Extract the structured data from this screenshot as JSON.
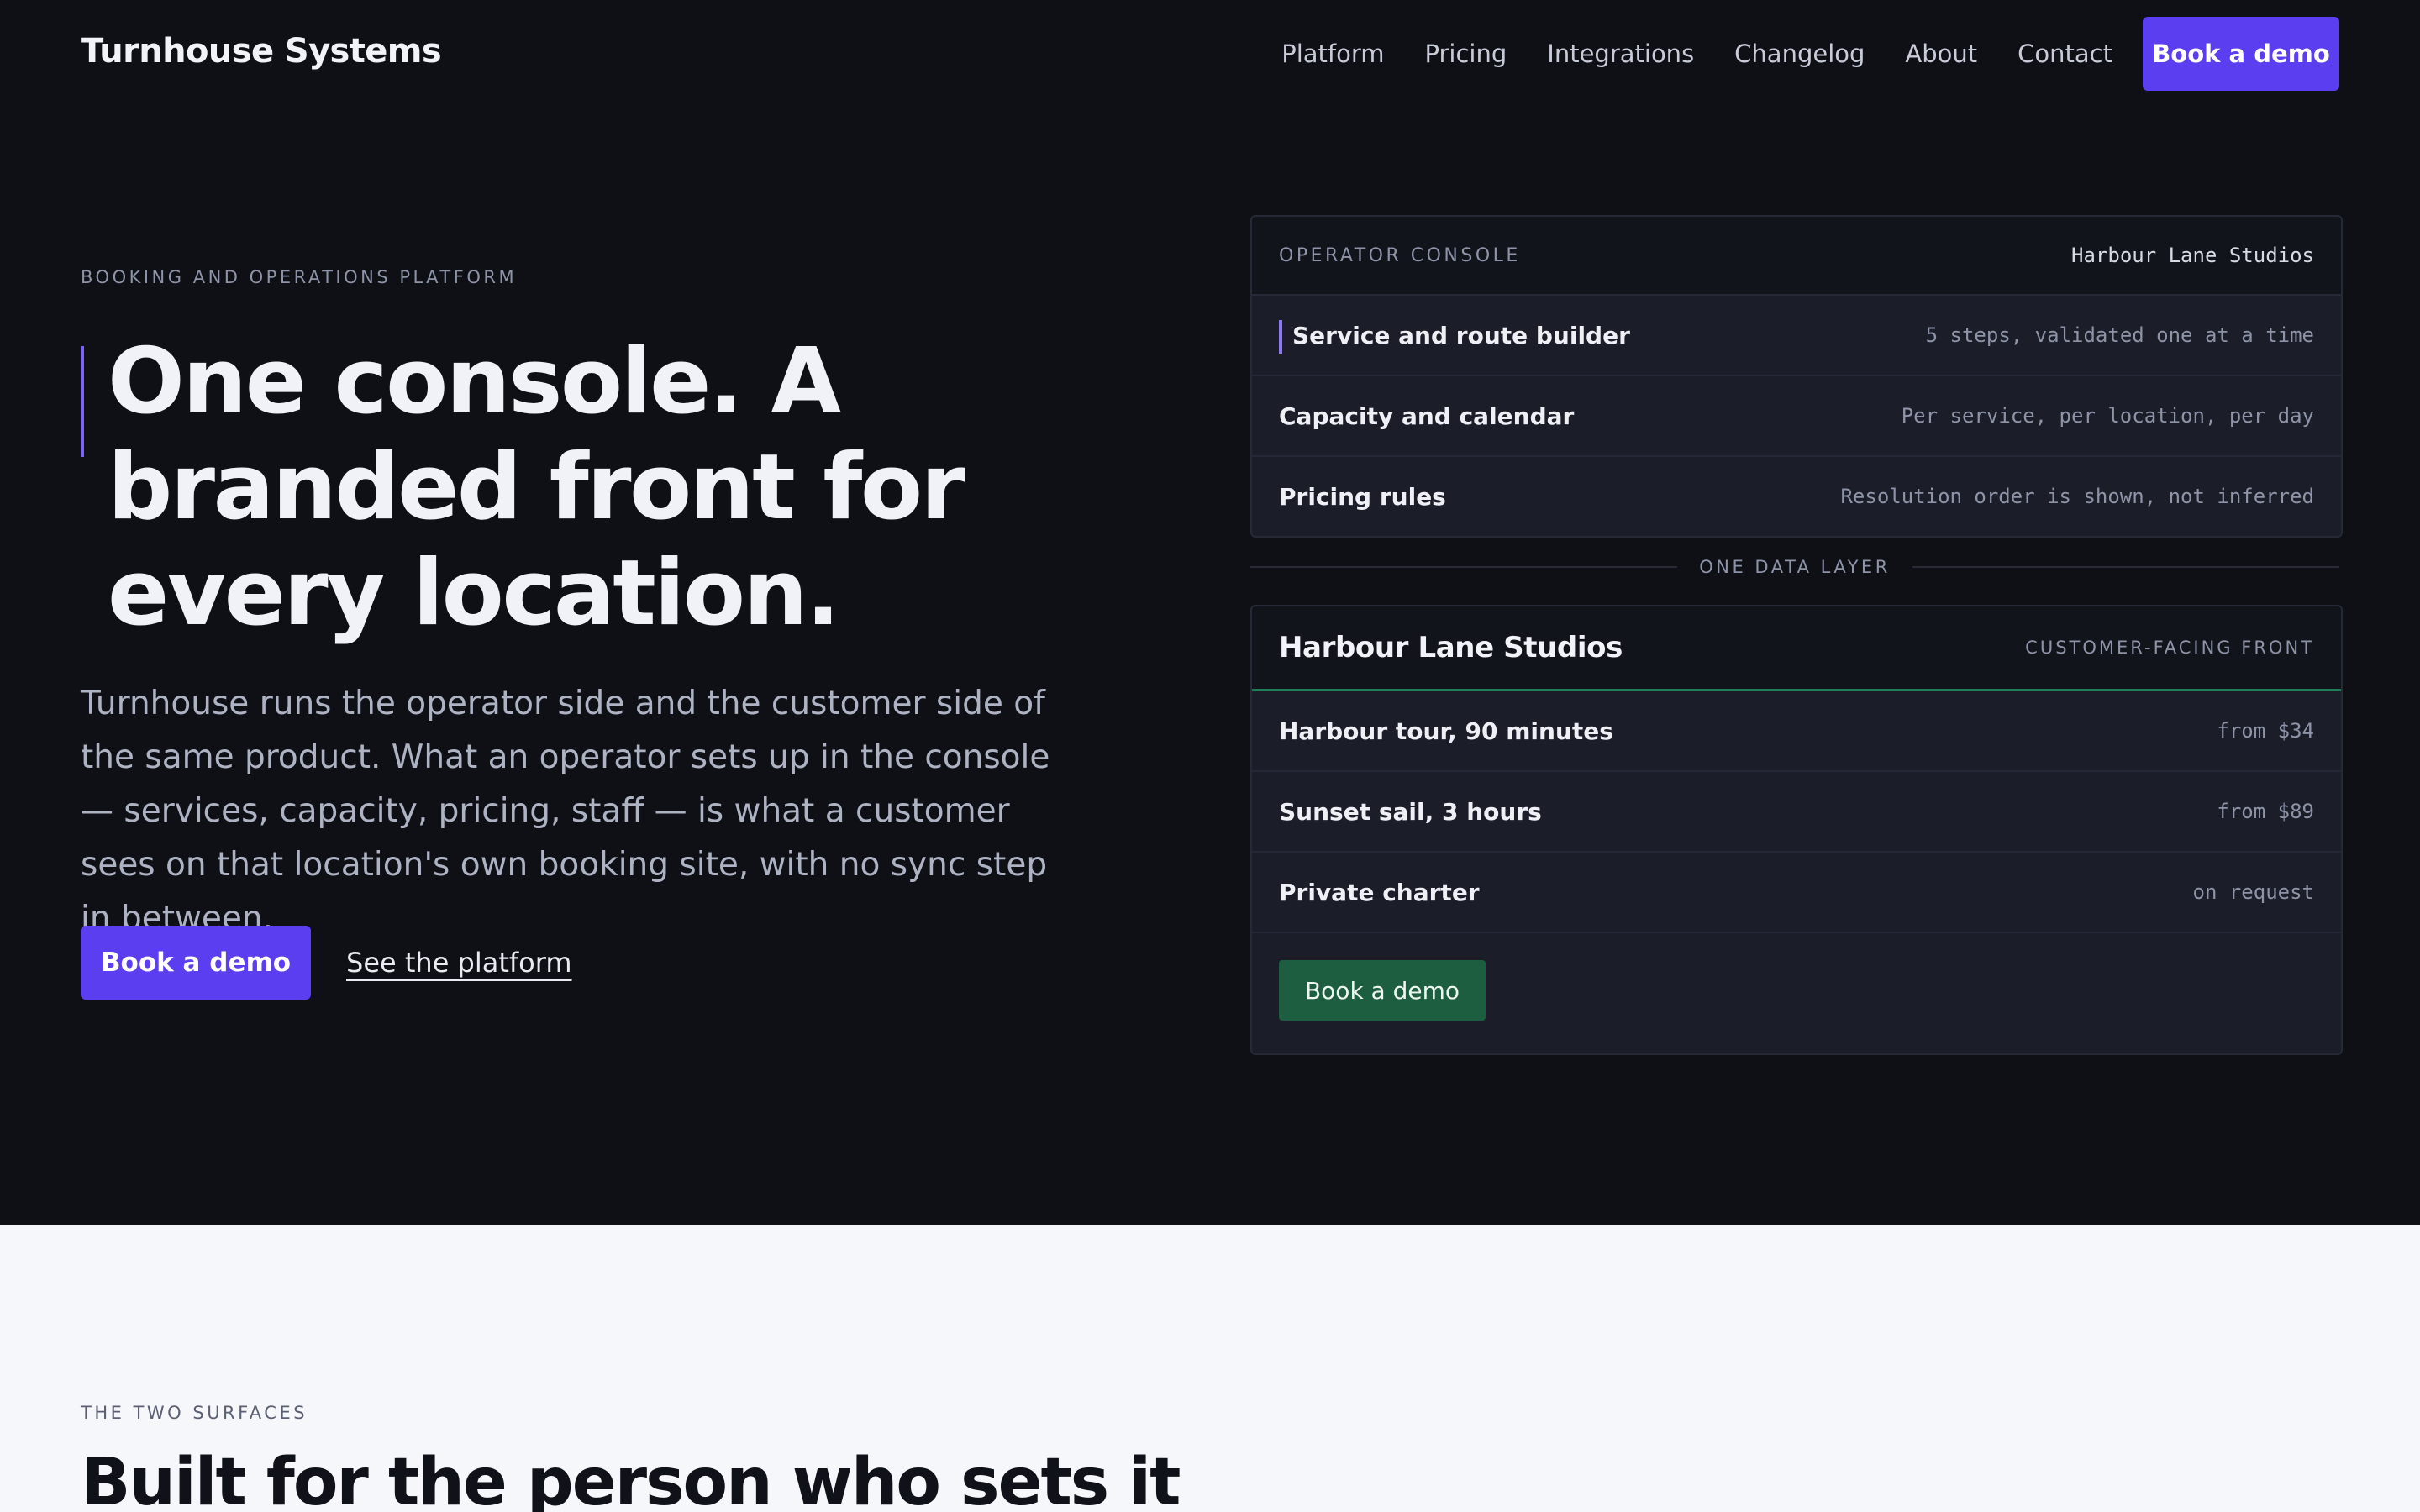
{
  "header": {
    "brand": "Turnhouse Systems",
    "nav": [
      "Platform",
      "Pricing",
      "Integrations",
      "Changelog",
      "About",
      "Contact"
    ],
    "cta": "Book a demo"
  },
  "hero": {
    "eyebrow": "BOOKING AND OPERATIONS PLATFORM",
    "title": "One console. A branded front for every location.",
    "body": "Turnhouse runs the operator side and the customer side of the same product. What an operator sets up in the console — services, capacity, pricing, staff — is what a customer sees on that location's own booking site, with no sync step in between.",
    "primary_cta": "Book a demo",
    "secondary_cta": "See the platform"
  },
  "console": {
    "label": "OPERATOR CONSOLE",
    "client": "Harbour Lane Studios",
    "rows": [
      {
        "label": "Service and route builder",
        "note": "5 steps, validated one at a time"
      },
      {
        "label": "Capacity and calendar",
        "note": "Per service, per location, per day"
      },
      {
        "label": "Pricing rules",
        "note": "Resolution order is shown, not inferred"
      }
    ]
  },
  "divider": "ONE DATA LAYER",
  "front": {
    "title": "Harbour Lane Studios",
    "tag": "CUSTOMER-FACING FRONT",
    "items": [
      {
        "name": "Harbour tour, 90 minutes",
        "price": "from $34"
      },
      {
        "name": "Sunset sail, 3 hours",
        "price": "from $89"
      },
      {
        "name": "Private charter",
        "price": "on request"
      }
    ],
    "cta": "Book a demo"
  },
  "lower": {
    "eyebrow": "THE TWO SURFACES",
    "title": "Built for the person who sets it"
  },
  "colors": {
    "background": "#0e1016",
    "accent": "#5b3ef0",
    "green": "#1d5e41",
    "light": "#f6f7fa"
  }
}
